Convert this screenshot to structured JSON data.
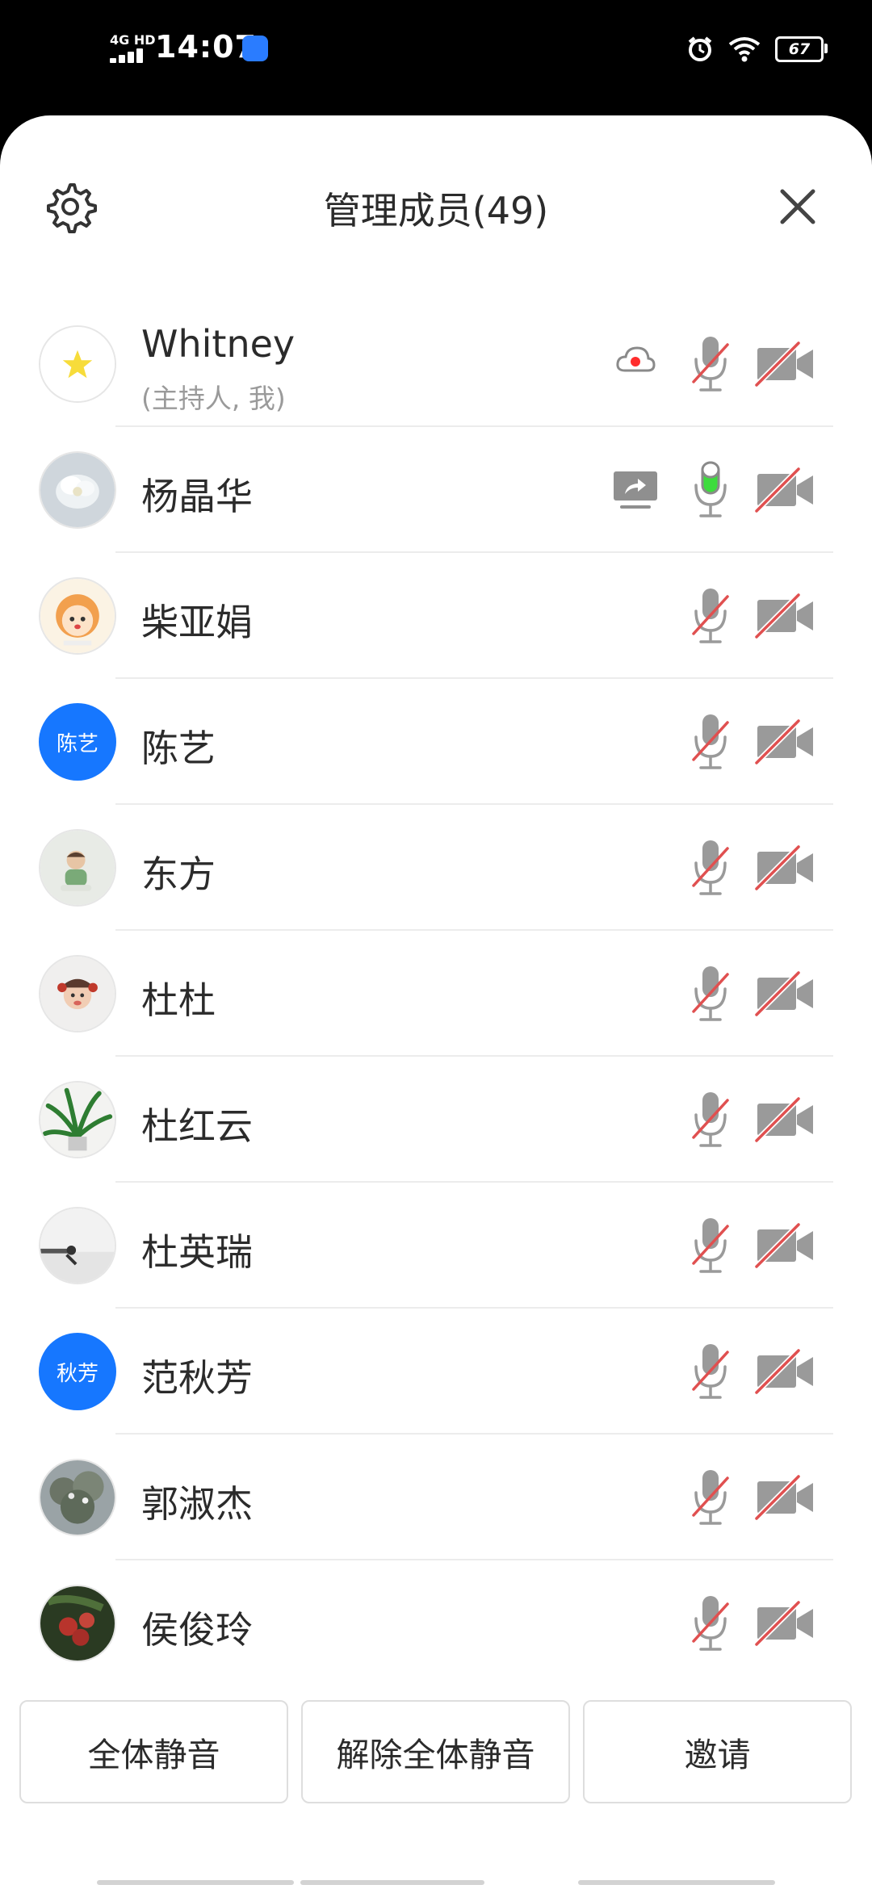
{
  "status_bar": {
    "network": "4G HD",
    "time": "14:07",
    "battery": "67",
    "icons": [
      "signal-icon",
      "app-notification-icon",
      "alarm-icon",
      "wifi-icon",
      "battery-icon"
    ]
  },
  "header": {
    "title": "管理成员(49)",
    "settings_icon": "gear-icon",
    "close_icon": "close-icon"
  },
  "members": [
    {
      "name": "Whitney",
      "role": "(主持人, 我)",
      "avatar": "star",
      "recording": true,
      "sharing": false,
      "mic": "muted",
      "camera": "off"
    },
    {
      "name": "杨晶华",
      "avatar": "flower",
      "recording": false,
      "sharing": true,
      "mic": "active",
      "camera": "off"
    },
    {
      "name": "柴亚娟",
      "avatar": "cartoon-girl",
      "recording": false,
      "sharing": false,
      "mic": "muted",
      "camera": "off"
    },
    {
      "name": "陈艺",
      "avatar_text": "陈艺",
      "recording": false,
      "sharing": false,
      "mic": "muted",
      "camera": "off"
    },
    {
      "name": "东方",
      "avatar": "baby-photo",
      "recording": false,
      "sharing": false,
      "mic": "muted",
      "camera": "off"
    },
    {
      "name": "杜杜",
      "avatar": "child-photo",
      "recording": false,
      "sharing": false,
      "mic": "muted",
      "camera": "off"
    },
    {
      "name": "杜红云",
      "avatar": "plant-photo",
      "recording": false,
      "sharing": false,
      "mic": "muted",
      "camera": "off"
    },
    {
      "name": "杜英瑞",
      "avatar": "landscape-photo",
      "recording": false,
      "sharing": false,
      "mic": "muted",
      "camera": "off"
    },
    {
      "name": "范秋芳",
      "avatar_text": "秋芳",
      "recording": false,
      "sharing": false,
      "mic": "muted",
      "camera": "off"
    },
    {
      "name": "郭淑杰",
      "avatar": "tree-photo",
      "recording": false,
      "sharing": false,
      "mic": "muted",
      "camera": "off"
    },
    {
      "name": "侯俊玲",
      "avatar": "fruit-photo",
      "recording": false,
      "sharing": false,
      "mic": "muted",
      "camera": "off"
    }
  ],
  "actions": {
    "mute_all": "全体静音",
    "unmute_all": "解除全体静音",
    "invite": "邀请"
  },
  "colors": {
    "accent_blue": "#1677ff",
    "mute_red": "#e05050",
    "mic_active_green": "#3ddc3d",
    "recording_red": "#ff2d2d"
  }
}
